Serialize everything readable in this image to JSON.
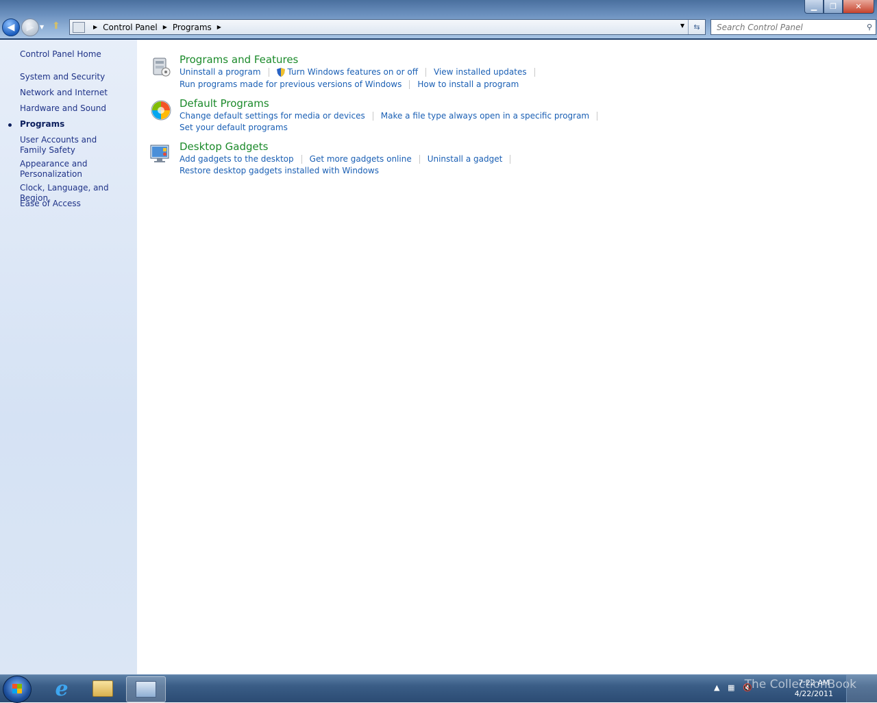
{
  "window": {
    "controls": {
      "minimize": "▁",
      "maximize": "❐",
      "close": "✕"
    }
  },
  "address_bar": {
    "breadcrumbs": [
      "Control Panel",
      "Programs"
    ]
  },
  "search": {
    "placeholder": "Search Control Panel"
  },
  "left_pane": {
    "home": "Control Panel Home",
    "items": [
      {
        "label": "System and Security"
      },
      {
        "label": "Network and Internet"
      },
      {
        "label": "Hardware and Sound"
      },
      {
        "label": "Programs",
        "current": true
      },
      {
        "label": "User Accounts and Family Safety"
      },
      {
        "label": "Appearance and Personalization"
      },
      {
        "label": "Clock, Language, and Region"
      },
      {
        "label": "Ease of Access"
      }
    ]
  },
  "sections": [
    {
      "title": "Programs and Features",
      "icon": "programs-features-icon",
      "rows": [
        [
          "Uninstall a program",
          "Turn Windows features on or off",
          "View installed updates"
        ],
        [
          "Run programs made for previous versions of Windows",
          "How to install a program"
        ]
      ]
    },
    {
      "title": "Default Programs",
      "icon": "default-programs-icon",
      "rows": [
        [
          "Change default settings for media or devices",
          "Make a file type always open in a specific program"
        ],
        [
          "Set your default programs"
        ]
      ]
    },
    {
      "title": "Desktop Gadgets",
      "icon": "desktop-gadgets-icon",
      "rows": [
        [
          "Add gadgets to the desktop",
          "Get more gadgets online",
          "Uninstall a gadget"
        ],
        [
          "Restore desktop gadgets installed with Windows"
        ]
      ]
    }
  ],
  "taskbar": {
    "time": "7:22 AM",
    "date": "4/22/2011",
    "watermark": "The CollectionBook"
  }
}
